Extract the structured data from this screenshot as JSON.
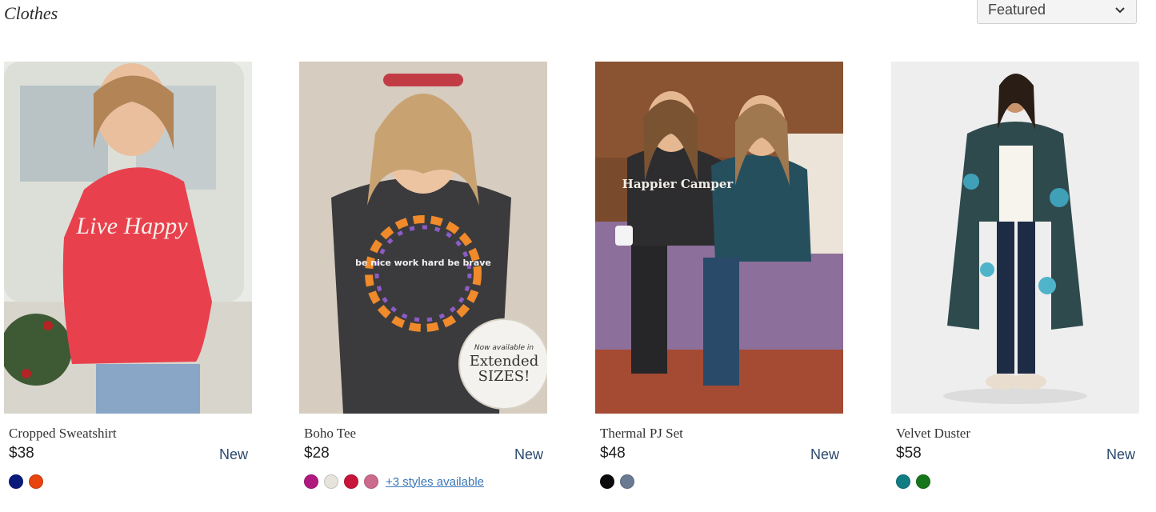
{
  "page": {
    "title": "Clothes"
  },
  "sort": {
    "selected": "Featured"
  },
  "products": [
    {
      "name": "Cropped Sweatshirt",
      "price": "$38",
      "badge": "New",
      "image_text": "Live Happy",
      "swatches": [
        "#0a1a7a",
        "#e8440e"
      ],
      "more": ""
    },
    {
      "name": "Boho Tee",
      "price": "$28",
      "badge": "New",
      "image_text": "be nice work hard be brave",
      "sticker": {
        "line1": "Now available in",
        "line2": "Extended",
        "line3": "SIZES!"
      },
      "swatches": [
        "#b0197e",
        "#e6e4dc",
        "#c8143a",
        "#cc6a8e"
      ],
      "more": "+3 styles available"
    },
    {
      "name": "Thermal PJ Set",
      "price": "$48",
      "badge": "New",
      "image_text": "Happier Camper",
      "swatches": [
        "#0b0b0b",
        "#6a7a92"
      ],
      "more": ""
    },
    {
      "name": "Velvet Duster",
      "price": "$58",
      "badge": "New",
      "image_text": "",
      "swatches": [
        "#0f7d82",
        "#16761b"
      ],
      "more": ""
    }
  ]
}
